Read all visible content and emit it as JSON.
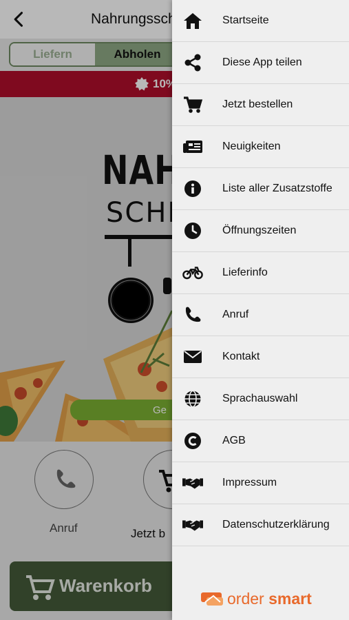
{
  "app": {
    "title": "Nahrungsschm",
    "tabs": [
      "Liefern",
      "Abholen"
    ],
    "promo_text": "10%",
    "logo_line1": "NAHR",
    "logo_line2": "SCHM",
    "hero_button": "Ge",
    "call_label": "Anruf",
    "order_label": "Jetzt b",
    "cart_label": "Warenkorb"
  },
  "menu": {
    "items": [
      {
        "label": "Startseite",
        "icon": "home-icon"
      },
      {
        "label": "Diese App teilen",
        "icon": "share-icon"
      },
      {
        "label": "Jetzt bestellen",
        "icon": "cart-icon"
      },
      {
        "label": "Neuigkeiten",
        "icon": "news-icon"
      },
      {
        "label": "Liste aller Zusatzstoffe",
        "icon": "info-icon"
      },
      {
        "label": "Öffnungszeiten",
        "icon": "clock-icon"
      },
      {
        "label": "Lieferinfo",
        "icon": "motorcycle-icon"
      },
      {
        "label": "Anruf",
        "icon": "phone-icon"
      },
      {
        "label": "Kontakt",
        "icon": "mail-icon"
      },
      {
        "label": "Sprachauswahl",
        "icon": "globe-icon"
      },
      {
        "label": "AGB",
        "icon": "copyright-icon"
      },
      {
        "label": "Impressum",
        "icon": "handshake-icon"
      },
      {
        "label": "Datenschutzerklärung",
        "icon": "handshake-icon"
      }
    ]
  },
  "brand": {
    "text_light": "order ",
    "text_bold": "smart",
    "color": "#e8692b"
  },
  "colors": {
    "promo": "#b10f2b",
    "green_button": "#7cb133",
    "cart": "#455a3a",
    "drawer": "#efefef"
  }
}
